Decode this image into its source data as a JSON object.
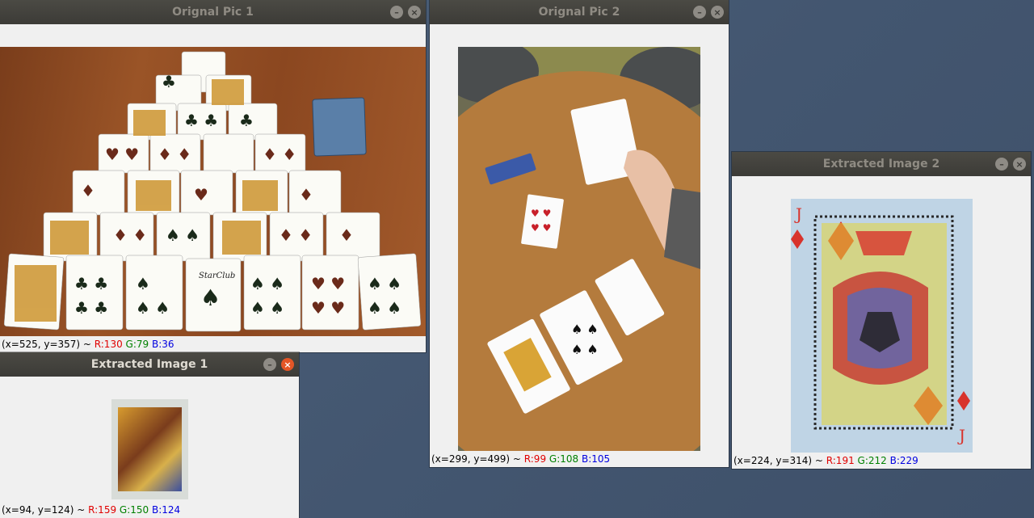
{
  "windows": {
    "orig1": {
      "title": "Orignal Pic 1",
      "status": {
        "coords": "(x=525, y=357) ~ ",
        "r": "R:130",
        "g": "G:79",
        "b": "B:36"
      }
    },
    "orig2": {
      "title": "Orignal Pic 2",
      "status": {
        "coords": "(x=299, y=499) ~ ",
        "r": "R:99",
        "g": "G:108",
        "b": "B:105"
      }
    },
    "ext1": {
      "title": "Extracted Image 1",
      "status": {
        "coords": "(x=94, y=124) ~ ",
        "r": "R:159",
        "g": "G:150",
        "b": "B:124"
      }
    },
    "ext2": {
      "title": "Extracted Image 2",
      "status": {
        "coords": "(x=224, y=314) ~ ",
        "r": "R:191",
        "g": "G:212",
        "b": "B:229"
      }
    }
  },
  "buttons": {
    "minimize": "–",
    "close": "×"
  },
  "images": {
    "pic1": {
      "card_text": "StarClub"
    }
  },
  "colors": {
    "table_wood": "#8a4a22",
    "desk_tan": "#b7813f",
    "titlebar": "#3c3b37",
    "close_button": "#e45626"
  }
}
